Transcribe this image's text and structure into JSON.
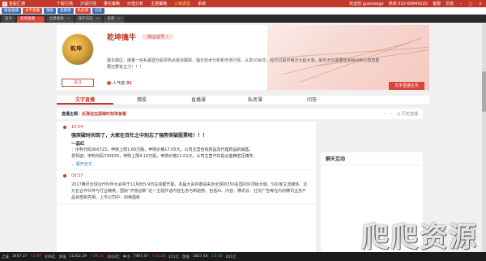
{
  "app": {
    "logo_text": "金股汇通",
    "logo_mark": "金",
    "menu": [
      "个股行情",
      "沪深行情",
      "量化策略",
      "价值分析",
      "主题策略",
      "三维课堂",
      "系统"
    ],
    "account_label": "欢迎您 guestsego",
    "hotline": "热线 010-60845020",
    "account_links": [
      "客服",
      "交易"
    ]
  },
  "toolbar": {
    "buttons": [
      "极速直播",
      "文字直播",
      "猜股",
      "直播课",
      "私房课",
      "问答"
    ]
  },
  "tabs": [
    {
      "label": "首页",
      "active": false
    },
    {
      "label": "名师直播",
      "active": true
    },
    {
      "label": "全景看盘",
      "active": false
    },
    {
      "label": "操作日志",
      "active": false
    },
    {
      "label": "名师",
      "active": false
    }
  ],
  "profile": {
    "name": "乾坤擒牛",
    "certificate": "（执业证号：）",
    "intro": "擅长擒庄，擒量一些私募建仓股票热点板块跟踪，擅长技术分析和市场行情，从发10余年，经历过股市两次大起大落，股市不仅需要技术和分析心态但重要还要有主力！！！",
    "follow_label": "关注",
    "popularity_label": "人气值",
    "popularity_value": "91",
    "live_home_label": "文字直播主页"
  },
  "section_tabs": [
    {
      "label": "文字直播",
      "active": true
    },
    {
      "label": "猜股",
      "active": false
    },
    {
      "label": "直播课",
      "active": false
    },
    {
      "label": "私房课",
      "active": false
    },
    {
      "label": "问答",
      "active": false
    }
  ],
  "live": {
    "topic_prefix": "直播主题：",
    "topic": "反弹迫在眉睫时刻准备着",
    "history_label": "历史直播"
  },
  "posts": [
    {
      "time": "10:04",
      "title": "强突破时间到了，大家在百忙之中别忘了强势突破股票哈！！！",
      "subtitle": "一品红",
      "lines": [
        {
          "text": "：中构代码300723，申购上限1.60万股，申购价格17.05元，公司主营自有药品及代理药品的销售。",
          "red": false
        },
        {
          "text": "爱柯迪：申构代码730933，申购上限4.10万股，申购价格11.01元，公司主营汽车铝合金精密压铸件。",
          "red": false
        }
      ],
      "expand_label": "展开全文"
    },
    {
      "time": "09:57",
      "body": "2017腾讯全球合作伙伴大会将于11月8日-9日在成都开幕。本届大会将邀请来自全球的350名国内外顶级大咖、500家主流媒体、近万名合作伙伴与行业精英，围绕“开放创新”这一主题共话内容生态与新趋势。包括AI、内容、腾讯云、社交广告等在内的腾讯业务产品将悉数亮相，上市公司中：四维图新"
    }
  ],
  "sidebar": {
    "title": "聊天互动"
  },
  "ticker": {
    "items": [
      {
        "label": "上证",
        "value": "3407.37",
        "change": "↑5.97",
        "dir": "up"
      },
      {
        "label": "",
        "value": "656亿",
        "change": "",
        "dir": "none"
      },
      {
        "label": "深证",
        "value": "11302.39",
        "change": "↑39.11",
        "dir": "up"
      },
      {
        "label": "",
        "value": "1043亿",
        "change": "",
        "dir": "none"
      },
      {
        "label": "中小",
        "value": "7467.47",
        "change": "↑21.28",
        "dir": "up"
      },
      {
        "label": "",
        "value": "311亿",
        "change": "",
        "dir": "none"
      },
      {
        "label": "创业",
        "value": "1827.44",
        "change": "↓3.54",
        "dir": "down"
      },
      {
        "label": "",
        "value": "201亿",
        "change": "",
        "dir": "none"
      }
    ]
  },
  "watermark": "爬爬资源"
}
